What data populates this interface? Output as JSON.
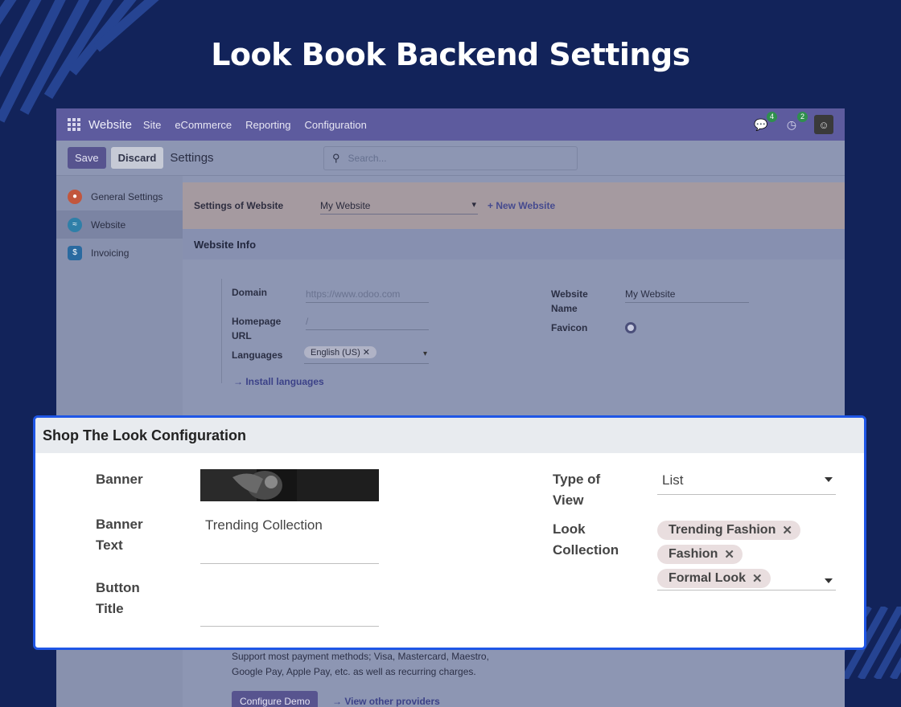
{
  "page_title": "Look Book Backend Settings",
  "navbar": {
    "brand": "Website",
    "menus": [
      "Site",
      "eCommerce",
      "Reporting",
      "Configuration"
    ],
    "messages_count": "4",
    "activities_count": "2"
  },
  "controlbar": {
    "save_label": "Save",
    "discard_label": "Discard",
    "title": "Settings",
    "search_placeholder": "Search..."
  },
  "sidebar": {
    "items": [
      {
        "label": "General Settings",
        "icon": "odoo-icon"
      },
      {
        "label": "Website",
        "icon": "website-icon"
      },
      {
        "label": "Invoicing",
        "icon": "invoicing-icon"
      }
    ]
  },
  "website_bar": {
    "label": "Settings of Website",
    "selected": "My Website",
    "new_link": "+ New Website"
  },
  "website_info": {
    "heading": "Website Info",
    "domain_label": "Domain",
    "domain_placeholder": "https://www.odoo.com",
    "homepage_label": "Homepage URL",
    "homepage_value": "/",
    "languages_label": "Languages",
    "language_tag": "English (US)",
    "install_link": "Install languages",
    "website_name_label": "Website Name",
    "website_name_value": "My Website",
    "favicon_label": "Favicon"
  },
  "payment": {
    "description": "Support most payment methods; Visa, Mastercard, Maestro, Google Pay, Apple Pay, etc. as well as recurring charges.",
    "configure_label": "Configure Demo",
    "providers_link": "View other providers"
  },
  "shop_look": {
    "heading": "Shop The Look Configuration",
    "banner_label": "Banner",
    "banner_text_label": "Banner Text",
    "banner_text_value": "Trending Collection",
    "button_title_label": "Button Title",
    "button_title_value": "",
    "type_label": "Type of View",
    "type_value": "List",
    "collection_label": "Look Collection",
    "collections": [
      "Trending Fashion",
      "Fashion",
      "Formal Look"
    ]
  },
  "colors": {
    "background": "#12235a",
    "accent_border": "#1f56e6",
    "primary": "#57548f"
  }
}
